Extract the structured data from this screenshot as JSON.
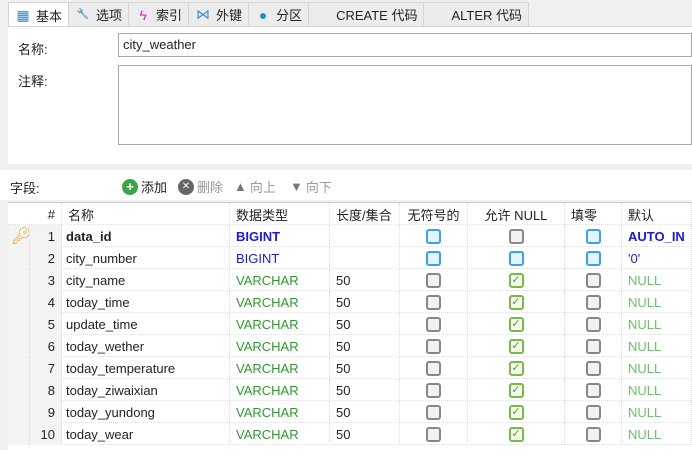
{
  "tabs": [
    {
      "label": "基本",
      "icon": "table-icon"
    },
    {
      "label": "选项",
      "icon": "wrench-icon"
    },
    {
      "label": "索引",
      "icon": "lightning-icon"
    },
    {
      "label": "外键",
      "icon": "foreign-key-icon"
    },
    {
      "label": "分区",
      "icon": "pie-icon"
    },
    {
      "label": "CREATE 代码",
      "icon": "code-icon"
    },
    {
      "label": "ALTER 代码",
      "icon": "code-icon"
    }
  ],
  "form": {
    "name_label": "名称:",
    "name_value": "city_weather",
    "comment_label": "注释:",
    "comment_value": ""
  },
  "fields": {
    "label": "字段:",
    "add": "添加",
    "delete": "删除",
    "up": "向上",
    "down": "向下"
  },
  "columns": [
    "#",
    "名称",
    "数据类型",
    "长度/集合",
    "无符号的",
    "允许 NULL",
    "填零",
    "默认"
  ],
  "rows": [
    {
      "n": "1",
      "name": "data_id",
      "type": "BIGINT",
      "len": "",
      "unsigned": false,
      "nullable": false,
      "zerofill": false,
      "default": "AUTO_IN",
      "pk": true,
      "kind": "int"
    },
    {
      "n": "2",
      "name": "city_number",
      "type": "BIGINT",
      "len": "",
      "unsigned": false,
      "nullable": false,
      "zerofill": false,
      "default": "'0'",
      "pk": false,
      "kind": "int"
    },
    {
      "n": "3",
      "name": "city_name",
      "type": "VARCHAR",
      "len": "50",
      "unsigned": false,
      "nullable": true,
      "zerofill": false,
      "default": "NULL",
      "pk": false,
      "kind": "str"
    },
    {
      "n": "4",
      "name": "today_time",
      "type": "VARCHAR",
      "len": "50",
      "unsigned": false,
      "nullable": true,
      "zerofill": false,
      "default": "NULL",
      "pk": false,
      "kind": "str"
    },
    {
      "n": "5",
      "name": "update_time",
      "type": "VARCHAR",
      "len": "50",
      "unsigned": false,
      "nullable": true,
      "zerofill": false,
      "default": "NULL",
      "pk": false,
      "kind": "str"
    },
    {
      "n": "6",
      "name": "today_wether",
      "type": "VARCHAR",
      "len": "50",
      "unsigned": false,
      "nullable": true,
      "zerofill": false,
      "default": "NULL",
      "pk": false,
      "kind": "str"
    },
    {
      "n": "7",
      "name": "today_temperature",
      "type": "VARCHAR",
      "len": "50",
      "unsigned": false,
      "nullable": true,
      "zerofill": false,
      "default": "NULL",
      "pk": false,
      "kind": "str"
    },
    {
      "n": "8",
      "name": "today_ziwaixian",
      "type": "VARCHAR",
      "len": "50",
      "unsigned": false,
      "nullable": true,
      "zerofill": false,
      "default": "NULL",
      "pk": false,
      "kind": "str"
    },
    {
      "n": "9",
      "name": "today_yundong",
      "type": "VARCHAR",
      "len": "50",
      "unsigned": false,
      "nullable": true,
      "zerofill": false,
      "default": "NULL",
      "pk": false,
      "kind": "str"
    },
    {
      "n": "10",
      "name": "today_wear",
      "type": "VARCHAR",
      "len": "50",
      "unsigned": false,
      "nullable": true,
      "zerofill": false,
      "default": "NULL",
      "pk": false,
      "kind": "str"
    }
  ],
  "colors": {
    "int": "#1a1ae6",
    "str": "#2e9a2e",
    "null": "#6cc06c"
  }
}
